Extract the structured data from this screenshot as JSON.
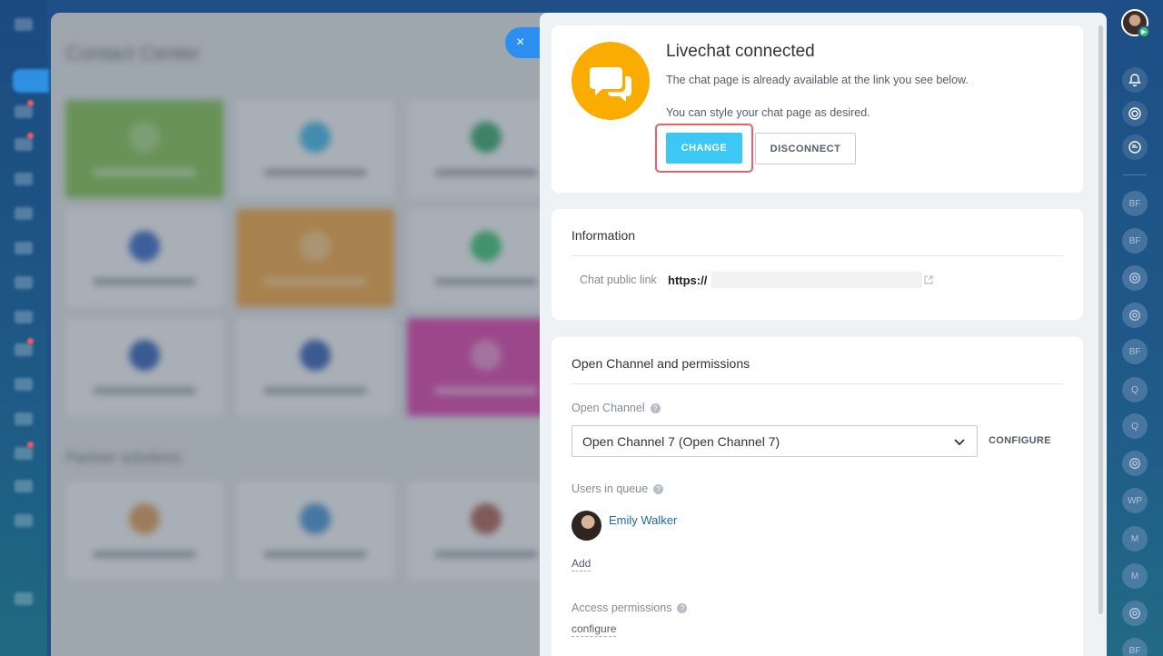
{
  "background": {
    "title": "Contact Center",
    "section_title": "Partner solutions"
  },
  "panel": {
    "close_icon": "×",
    "status": {
      "title": "Livechat connected",
      "line1": "The chat page is already available at the link you see below.",
      "line2": "You can style your chat page as desired.",
      "change_label": "CHANGE",
      "disconnect_label": "DISCONNECT"
    },
    "information": {
      "title": "Information",
      "link_label": "Chat public link",
      "link_value": "https://"
    },
    "channel": {
      "title": "Open Channel and permissions",
      "open_channel_label": "Open Channel",
      "open_channel_value": "Open Channel 7 (Open Channel 7)",
      "configure_label": "CONFIGURE",
      "users_label": "Users in queue",
      "user_name": "Emily Walker",
      "add_label": "Add",
      "access_label": "Access permissions",
      "access_link": "configure",
      "help_glyph": "?"
    }
  },
  "right_rail": {
    "chips": [
      "BF",
      "BF",
      "",
      "",
      "BF",
      "Q",
      "Q",
      "",
      "WP",
      "M",
      "M",
      "",
      "BF"
    ]
  },
  "colors": {
    "accent": "#3bc8f5",
    "livechat_orange": "#fbac00",
    "highlight_red": "#e8606a",
    "link_blue": "#2067b0"
  }
}
